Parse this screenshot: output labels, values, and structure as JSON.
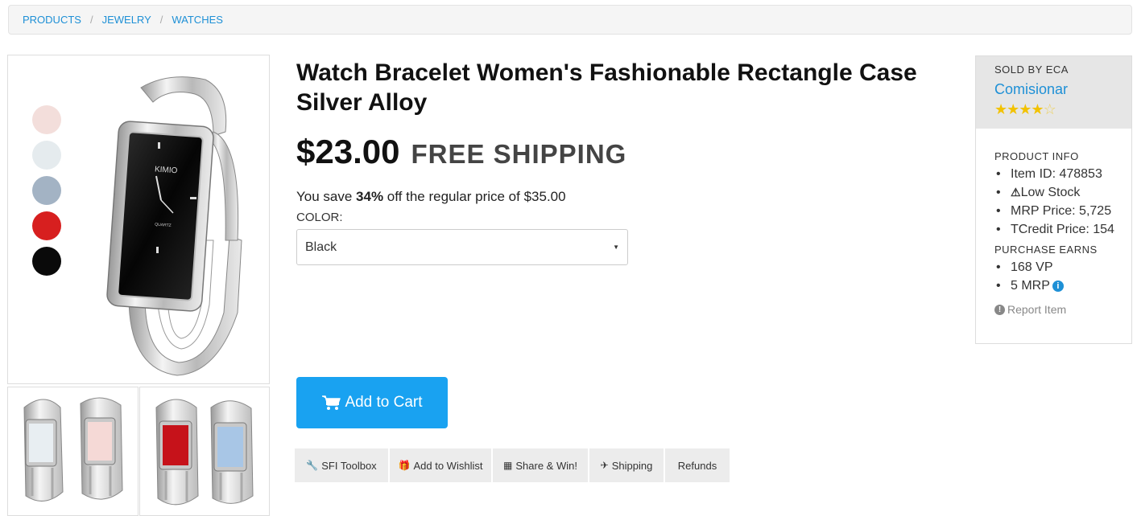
{
  "breadcrumb": [
    "PRODUCTS",
    "JEWELRY",
    "WATCHES"
  ],
  "breadcrumb_separator": "/",
  "product": {
    "title": "Watch Bracelet Women's Fashionable Rectangle Case Silver Alloy",
    "price": "$23.00",
    "shipping": "FREE SHIPPING",
    "savings_prefix": "You save ",
    "savings_percent": "34%",
    "savings_suffix": " off the regular price of $35.00",
    "color_label": "COLOR:",
    "color_selected": "Black",
    "swatches": [
      "#f3dedb",
      "#e5ebee",
      "#a3b3c4",
      "#d71f1f",
      "#0a0a0a"
    ],
    "watch_brand_text": "KIMIO",
    "watch_dial_text": "QUARTZ"
  },
  "actions": {
    "add_to_cart": "Add to Cart",
    "toolbar": [
      {
        "label": "SFI Toolbox",
        "icon": "wrench-icon"
      },
      {
        "label": "Add to Wishlist",
        "icon": "gift-icon"
      },
      {
        "label": "Share & Win!",
        "icon": "share-icon"
      },
      {
        "label": "Shipping",
        "icon": "plane-icon"
      },
      {
        "label": "Refunds",
        "icon": ""
      }
    ]
  },
  "seller": {
    "sold_by": "SOLD BY ECA",
    "name": "Comisionar",
    "rating_stars": 4,
    "rating_max": 5
  },
  "product_info": {
    "title": "PRODUCT INFO",
    "item_id": "Item ID: 478853",
    "stock": "Low Stock",
    "mrp_price": "MRP Price: 5,725",
    "tcredit_price": "TCredit Price: 154"
  },
  "purchase_earns": {
    "title": "PURCHASE EARNS",
    "vp": "168 VP",
    "mrp": "5 MRP"
  },
  "report": "Report Item",
  "colors": {
    "accent": "#19a2f1",
    "link": "#1e90d6",
    "star": "#f2c200"
  }
}
